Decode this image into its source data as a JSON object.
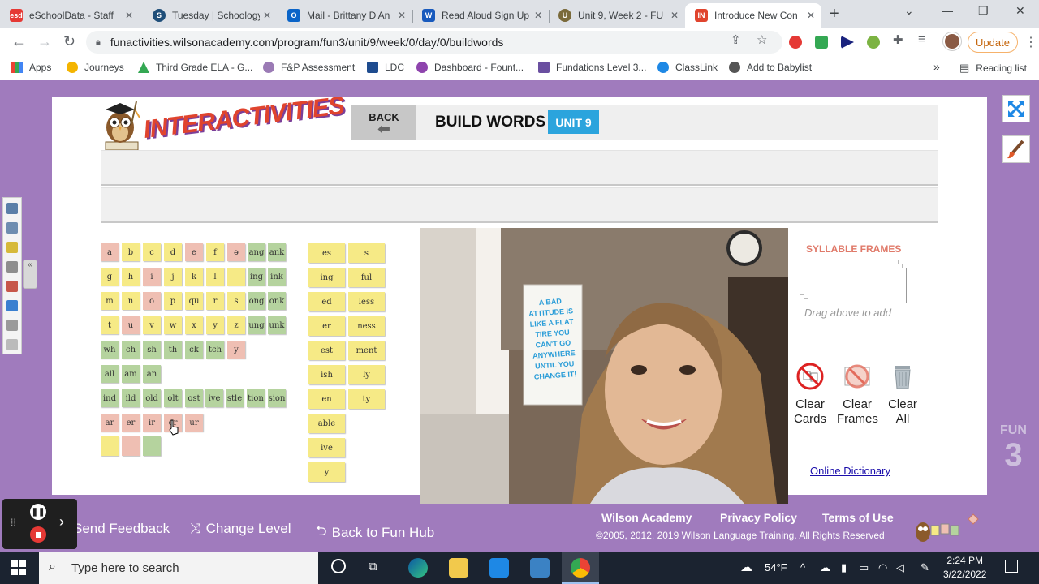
{
  "browser": {
    "tabs": [
      {
        "title": "eSchoolData - Staff",
        "icon_text": "esd",
        "icon_color": "#e53935"
      },
      {
        "title": "Tuesday | Schoology",
        "icon_text": "S",
        "icon_color": "#1f4e79"
      },
      {
        "title": "Mail - Brittany D'An",
        "icon_text": "O",
        "icon_color": "#0a64c8"
      },
      {
        "title": "Read Aloud Sign Up",
        "icon_text": "W",
        "icon_color": "#185abd"
      },
      {
        "title": "Unit 9, Week 2 - FU",
        "icon_text": "U",
        "icon_color": "#7a6a3a"
      },
      {
        "title": "Introduce New Con",
        "icon_text": "IN",
        "icon_color": "#e0442e"
      }
    ],
    "url": "funactivities.wilsonacademy.com/program/fun3/unit/9/week/0/day/0/buildwords",
    "update_label": "Update",
    "bookmarks": [
      {
        "label": "Apps",
        "color": "#ea4335"
      },
      {
        "label": "Journeys",
        "color": "#f4b400"
      },
      {
        "label": "Third Grade ELA - G...",
        "color": "#34a853"
      },
      {
        "label": "F&P Assessment",
        "color": "#9b7bb5"
      },
      {
        "label": "LDC",
        "color": "#1e4c8f"
      },
      {
        "label": "Dashboard - Fount...",
        "color": "#8e44ad"
      },
      {
        "label": "Fundations Level 3...",
        "color": "#6a4fa0"
      },
      {
        "label": "ClassLink",
        "color": "#1e88e5"
      },
      {
        "label": "Add to Babylist",
        "color": "#555555"
      }
    ],
    "bookmarks_more": "»",
    "reading_list": "Reading list"
  },
  "activity": {
    "logo_text": "INTERACTIVITIES",
    "back_label": "BACK",
    "title": "BUILD WORDS",
    "unit_badge": "UNIT 9",
    "letter_tiles": [
      [
        "a",
        "b",
        "c",
        "d",
        "e",
        "f",
        "ə",
        "ang",
        "ank"
      ],
      [
        "g",
        "h",
        "i",
        "j",
        "k",
        "l",
        "",
        "ing",
        "ink"
      ],
      [
        "m",
        "n",
        "o",
        "p",
        "qu",
        "r",
        "s",
        "ong",
        "onk"
      ],
      [
        "t",
        "u",
        "v",
        "w",
        "x",
        "y",
        "z",
        "ung",
        "unk"
      ],
      [
        "wh",
        "ch",
        "sh",
        "th",
        "ck",
        "tch",
        "y"
      ],
      [
        "all",
        "am",
        "an"
      ],
      [
        "ind",
        "ild",
        "old",
        "olt",
        "ost",
        "ive",
        "stle",
        "tion",
        "sion"
      ],
      [
        "ar",
        "er",
        "ir",
        "or",
        "ur"
      ],
      [
        "",
        "",
        ""
      ]
    ],
    "suffix_tiles": [
      [
        "es",
        "s"
      ],
      [
        "ing",
        "ful"
      ],
      [
        "ed",
        "less"
      ],
      [
        "er",
        "ness"
      ],
      [
        "est",
        "ment"
      ],
      [
        "ish",
        "ly"
      ],
      [
        "en",
        "ty"
      ],
      [
        "able"
      ],
      [
        "ive"
      ],
      [
        "y"
      ]
    ],
    "syllable_frames_title": "SYLLABLE FRAMES",
    "drag_hint": "Drag above to add",
    "clear_cards": [
      "Clear",
      "Cards"
    ],
    "clear_frames": [
      "Clear",
      "Frames"
    ],
    "clear_all": [
      "Clear",
      "All"
    ],
    "dictionary_link": "Online Dictionary",
    "fun_badge": [
      "FUN",
      "3"
    ],
    "poster_text": "A BAD ATTITUDE IS LIKE A FLAT TIRE YOU CAN'T GO ANYWHERE UNTIL YOU CHANGE IT!"
  },
  "footer": {
    "send_feedback": "Send Feedback",
    "change_level": "Change Level",
    "back_to_hub": "Back to Fun Hub",
    "wilson_academy": "Wilson Academy",
    "privacy": "Privacy Policy",
    "terms": "Terms of Use",
    "copyright": "©2005, 2012, 2019 Wilson Language Training. All Rights Reserved",
    "fundations_logo": "fundations"
  },
  "taskbar": {
    "search_placeholder": "Type here to search",
    "weather": "54°F",
    "time": "2:24 PM",
    "date": "3/22/2022"
  }
}
